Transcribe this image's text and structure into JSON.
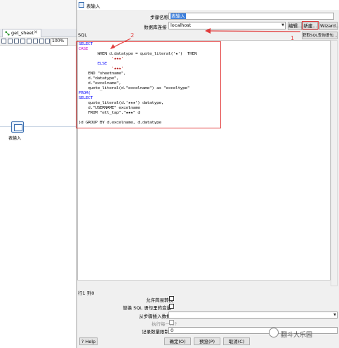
{
  "background": {
    "tab_label": "get_sheet",
    "tab_close": "✕",
    "zoom": "100%",
    "step_label": "表输入"
  },
  "dialog": {
    "title": "表输入",
    "step_name_label": "步骤名称",
    "step_name_value": "表输入",
    "connection_label": "数据库连接",
    "connection_value": "localhost",
    "edit_button": "编辑...",
    "new_button": "新建...",
    "wizard_button": "Wizard...",
    "get_sql_button": "获取SQL查询语句...",
    "sql_label": "SQL",
    "sql_lines": [
      {
        "kind": "kw",
        "text": "SELECT"
      },
      {
        "kind": "ck",
        "text": "CASE"
      },
      {
        "kind": "plain",
        "text": "        WHEN d.datatype = quote_literal('★')  THEN"
      },
      {
        "kind": "st",
        "text": "              '★★★'"
      },
      {
        "kind": "kw",
        "text": "        ELSE"
      },
      {
        "kind": "st",
        "text": "              '★★★'"
      },
      {
        "kind": "plain",
        "text": "    END \"sheetname\","
      },
      {
        "kind": "plain",
        "text": "    d.\"datatype\","
      },
      {
        "kind": "plain",
        "text": "    d.\"excelname\","
      },
      {
        "kind": "plain",
        "text": "    quote_literal(d.\"excelname\") as \"exceltype\""
      },
      {
        "kind": "kw",
        "text": "FROM("
      },
      {
        "kind": "kw",
        "text": "SELECT"
      },
      {
        "kind": "plain",
        "text": "    quote_literal(d.'★★★') datatype,"
      },
      {
        "kind": "plain",
        "text": "    d.\"USERNAME\" excelname"
      },
      {
        "kind": "plain",
        "text": "    FROM \"etl_tap\".\"★★★\" d"
      },
      {
        "kind": "plain",
        "text": ""
      },
      {
        "kind": "plain",
        "text": ")d GROUP BY d.excelname, d.datatype"
      }
    ],
    "position_status": "行1 列0",
    "allow_lazy_conversion_label": "允许简易转换",
    "replace_variables_label": "替换 SQL 语句里的变量",
    "insert_data_from_step_label": "从步骤插入数据",
    "execute_each_row_label": "执行每一行?",
    "limit_size_label": "记录数量限制",
    "limit_size_value": "0",
    "help_button": "Help",
    "ok_button": "确定(O)",
    "preview_button": "预览(P)",
    "cancel_button": "取消(C)"
  },
  "annotations": {
    "label_1": "1",
    "label_2": "2",
    "accent_color": "#e23b3b"
  },
  "watermark": {
    "text": "翻斗大乐园"
  }
}
